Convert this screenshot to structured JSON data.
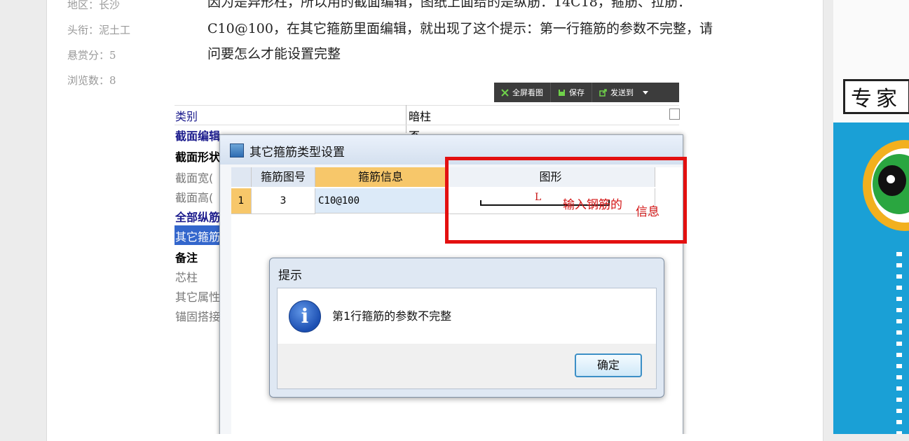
{
  "sidebar_meta": [
    {
      "text": "地区：长沙"
    },
    {
      "text": "头衔：泥土工"
    },
    {
      "text": "悬赏分：5"
    },
    {
      "text": "浏览数：8"
    }
  ],
  "question": {
    "line1": "因为是异形柱，所以用的截面编辑，图纸上面给的是纵筋：14C18，箍筋、拉筋：",
    "line2": "C10@100，在其它箍筋里面编辑，就出现了这个提示：第一行箍筋的参数不完整，请",
    "line3": "问要怎么才能设置完整"
  },
  "toolbar": {
    "fullscreen": "全屏看图",
    "save": "保存",
    "send": "发送到"
  },
  "properties": {
    "header_key": "类别",
    "header_value": "暗柱",
    "rows": [
      "截面编辑",
      "截面形状",
      "截面宽(",
      "截面高(",
      "全部纵筋",
      "其它箍筋",
      "备注",
      "芯柱",
      "其它属性",
      "锚固搭接"
    ],
    "row0_value": "否"
  },
  "stirrup_dialog": {
    "title": "其它箍筋类型设置",
    "col_index": "",
    "col_code": "箍筋图号",
    "col_info": "箍筋信息",
    "col_shape": "图形",
    "row_index": "1",
    "row_code": "3",
    "row_info": "C10@100",
    "shape_label": "L"
  },
  "annotation": {
    "text_a": "输入钢筋的",
    "text_b": "信息"
  },
  "alert": {
    "title": "提示",
    "message": "第1行箍筋的参数不完整",
    "ok": "确定"
  },
  "banner": {
    "sign": "专家"
  },
  "colors": {
    "annotation_red": "#e31010",
    "header_orange": "#f7c76a",
    "link_blue": "#1a1a8c"
  }
}
